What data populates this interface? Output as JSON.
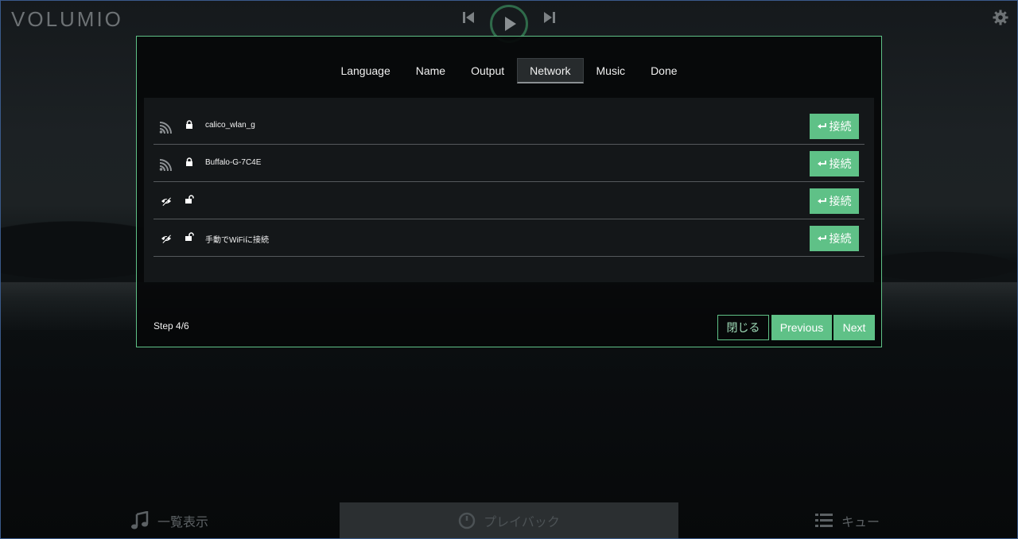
{
  "header": {
    "logo_text": "VOLUMIO"
  },
  "wizard": {
    "steps": [
      {
        "label": "Language"
      },
      {
        "label": "Name"
      },
      {
        "label": "Output"
      },
      {
        "label": "Network",
        "active": true
      },
      {
        "label": "Music"
      },
      {
        "label": "Done"
      }
    ],
    "networks": [
      {
        "ssid": "calico_wlan_g",
        "signal_icon": "wifi-signal-icon",
        "lock_icon": "lock-icon",
        "connect_label": "接続"
      },
      {
        "ssid": "Buffalo-G-7C4E",
        "signal_icon": "wifi-signal-icon",
        "lock_icon": "lock-icon",
        "connect_label": "接続"
      },
      {
        "ssid": "",
        "signal_icon": "hidden-network-icon",
        "lock_icon": "unlock-icon",
        "connect_label": "接続"
      },
      {
        "ssid": "手動でWiFiに接続",
        "signal_icon": "hidden-network-icon",
        "lock_icon": "unlock-icon",
        "connect_label": "接続"
      }
    ],
    "step_counter": "Step 4/6",
    "close_label": "閉じる",
    "previous_label": "Previous",
    "next_label": "Next"
  },
  "footer": {
    "browse_label": "一覧表示",
    "playback_label": "プレイバック",
    "queue_label": "キュー"
  },
  "colors": {
    "accent": "#5fc187"
  }
}
